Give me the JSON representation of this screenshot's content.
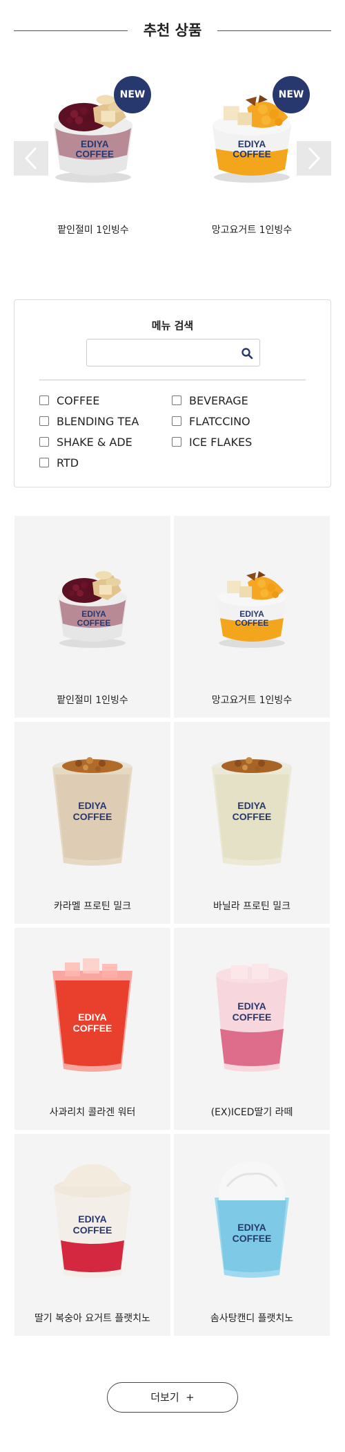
{
  "section": {
    "title": "추천 상품"
  },
  "recommended": [
    {
      "name": "팥인절미 1인빙수",
      "badge": "NEW",
      "icon": "bingsu-redbean-icon"
    },
    {
      "name": "망고요거트 1인빙수",
      "badge": "NEW",
      "icon": "bingsu-mango-icon"
    }
  ],
  "search": {
    "title": "메뉴 검색",
    "value": "",
    "categories": [
      "COFFEE",
      "BEVERAGE",
      "BLENDING TEA",
      "FLATCCINO",
      "SHAKE & ADE",
      "ICE FLAKES",
      "RTD"
    ]
  },
  "brand": {
    "line1": "EDIYA",
    "line2": "COFFEE",
    "accent": "#27386f"
  },
  "products": [
    {
      "name": "팥인절미 1인빙수",
      "icon": "bingsu-redbean-icon"
    },
    {
      "name": "망고요거트 1인빙수",
      "icon": "bingsu-mango-icon"
    },
    {
      "name": "카라멜 프로틴 밀크",
      "icon": "protein-milk-caramel-icon"
    },
    {
      "name": "바닐라 프로틴 밀크",
      "icon": "protein-milk-vanilla-icon"
    },
    {
      "name": "사과리치 콜라겐 워터",
      "icon": "collagen-water-icon"
    },
    {
      "name": "(EX)ICED딸기 라떼",
      "icon": "strawberry-latte-icon"
    },
    {
      "name": "딸기 복숭아 요거트 플랫치노",
      "icon": "yogurt-flatccino-icon"
    },
    {
      "name": "솜사탕캔디 플랫치노",
      "icon": "cotton-candy-flatccino-icon"
    }
  ],
  "more_button": {
    "label": "더보기  +"
  }
}
